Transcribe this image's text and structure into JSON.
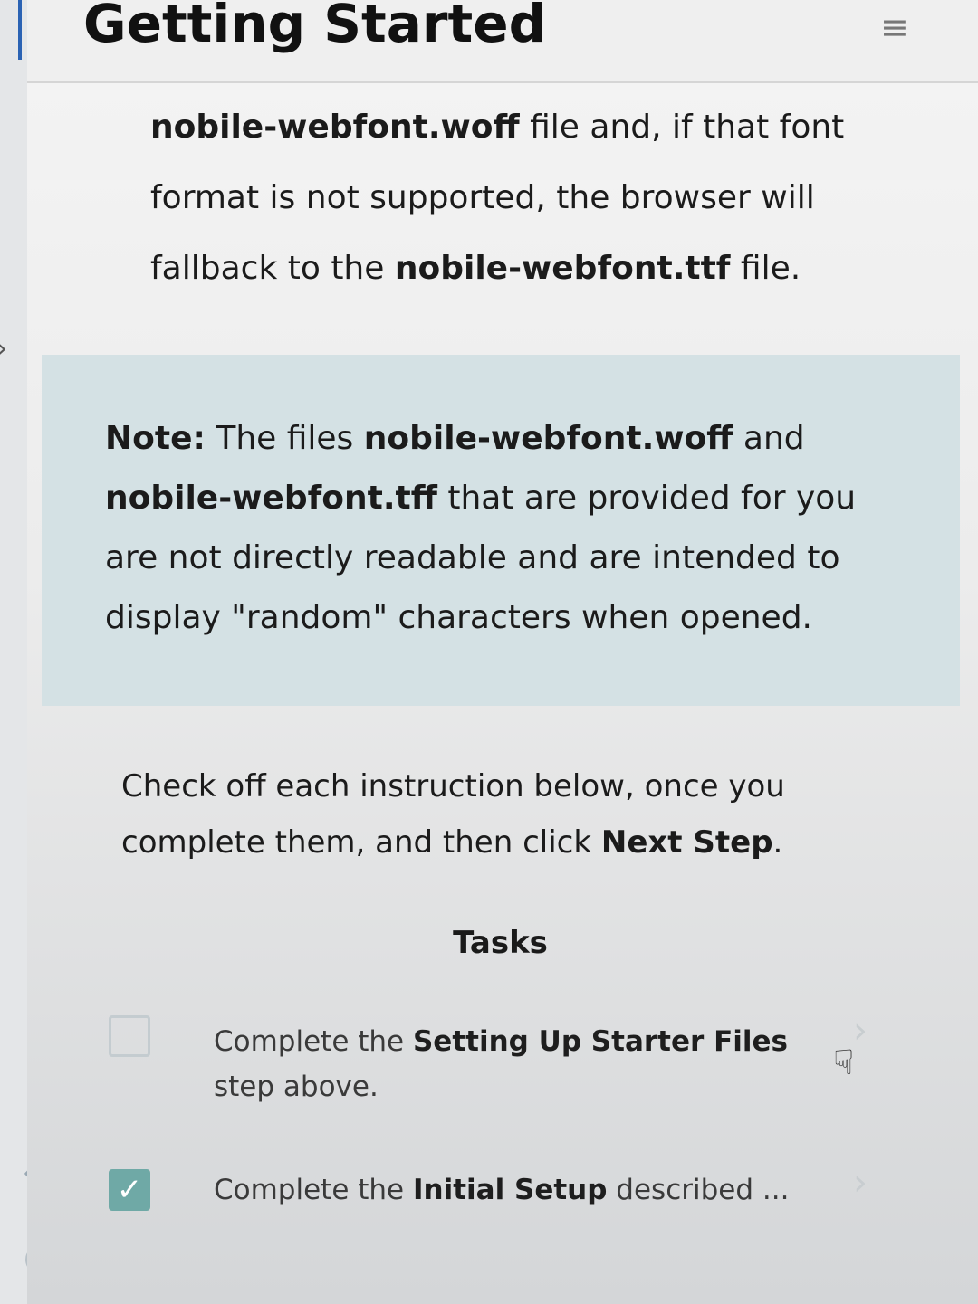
{
  "header": {
    "title": "Getting Started",
    "menu_icon": "hamburger-menu-icon"
  },
  "intro_paragraph": {
    "t1": "nobile-webfont.woff",
    "t2": " file and, if that font format is not supported, the browser will fallback to the ",
    "t3": "nobile-webfont.ttf",
    "t4": " file."
  },
  "note": {
    "label": "Note:",
    "t1": " The files ",
    "t2": "nobile-webfont.woff",
    "t3": " and ",
    "t4": "nobile-webfont.tff",
    "t5": " that are provided for you are not directly readable and are intended to display \"random\" characters when opened."
  },
  "check_intro": {
    "t1": "Check off each instruction below, once you complete them, and then click ",
    "t2": "Next Step",
    "t3": "."
  },
  "tasks": {
    "heading": "Tasks",
    "items": [
      {
        "prefix": "Complete the ",
        "bold": "Setting Up Starter Files",
        "suffix": " step above.",
        "checked": false
      },
      {
        "prefix": "Complete the ",
        "bold": "Initial Setup",
        "suffix": " described ...",
        "checked": true
      }
    ]
  },
  "colors": {
    "accent": "#2a62b3",
    "note_bg": "#d4e1e4",
    "checkbox_checked": "#6fa9a6"
  }
}
